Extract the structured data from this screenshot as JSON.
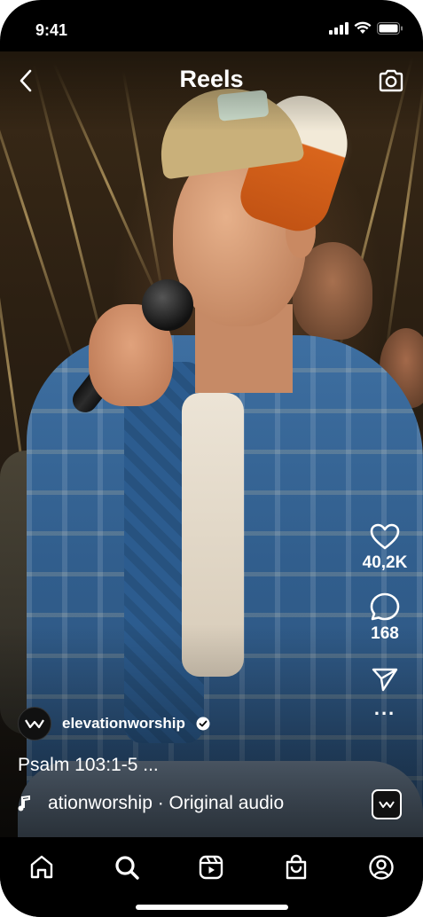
{
  "status_bar": {
    "time": "9:41",
    "icons": [
      "cellular-signal-icon",
      "wifi-icon",
      "battery-icon"
    ]
  },
  "header": {
    "title": "Reels",
    "back_icon": "chevron-left-icon",
    "camera_icon": "camera-icon"
  },
  "actions": {
    "likes": "40,2K",
    "comments": "168",
    "icons": [
      "heart-icon",
      "comment-icon",
      "send-icon",
      "more-icon"
    ],
    "more_label": "..."
  },
  "post": {
    "username": "elevationworship",
    "verified": true,
    "caption": "Psalm 103:1-5 ...",
    "audio": "ationworship · Original audio"
  },
  "nav": {
    "items": [
      "home-icon",
      "search-icon",
      "reels-icon",
      "shop-icon",
      "profile-icon"
    ]
  },
  "colors": {
    "background": "#000000",
    "text": "#ffffff"
  }
}
